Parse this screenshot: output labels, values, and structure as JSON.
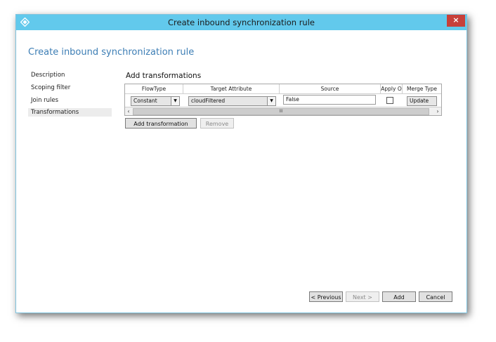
{
  "window": {
    "title": "Create inbound synchronization rule",
    "close_glyph": "×"
  },
  "page": {
    "heading": "Create inbound synchronization rule"
  },
  "nav": {
    "items": [
      {
        "label": "Description",
        "selected": false
      },
      {
        "label": "Scoping filter",
        "selected": false
      },
      {
        "label": "Join rules",
        "selected": false
      },
      {
        "label": "Transformations",
        "selected": true
      }
    ]
  },
  "section": {
    "title": "Add transformations"
  },
  "grid": {
    "columns": [
      "FlowType",
      "Target Attribute",
      "Source",
      "Apply O",
      "Merge Type"
    ],
    "rows": [
      {
        "flow_type": "Constant",
        "target_attribute": "cloudFiltered",
        "source": "False",
        "apply_once": false,
        "merge_type": "Update"
      }
    ],
    "scroll_thumb_glyph": "III"
  },
  "actions": {
    "add_transformation": "Add transformation",
    "remove": "Remove"
  },
  "footer": {
    "previous": "< Previous",
    "next": "Next >",
    "add": "Add",
    "cancel": "Cancel"
  },
  "colors": {
    "titlebar": "#62c9ec",
    "close": "#c7403a",
    "heading": "#3d7eb5"
  }
}
